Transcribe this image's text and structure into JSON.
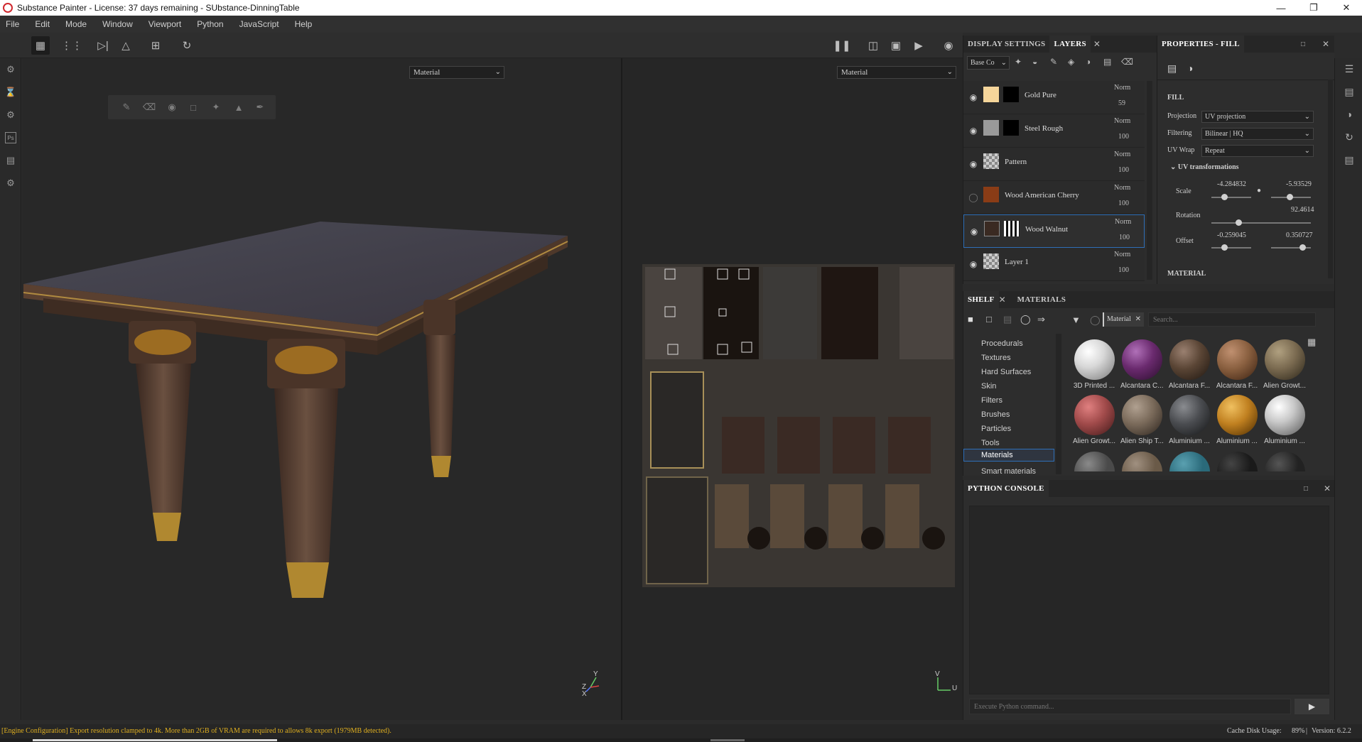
{
  "window": {
    "title": "Substance Painter - License: 37 days remaining - SUbstance-DinningTable"
  },
  "menu": [
    "File",
    "Edit",
    "Mode",
    "Window",
    "Viewport",
    "Python",
    "JavaScript",
    "Help"
  ],
  "viewports": {
    "left_mode": "Material",
    "right_mode": "Material"
  },
  "layers_panel": {
    "tabs": [
      "DISPLAY SETTINGS",
      "LAYERS"
    ],
    "channel_select": "Base Co",
    "layers": [
      {
        "name": "Gold Pure",
        "blend": "Norm",
        "opacity": "59",
        "visible": true,
        "color": "#f5d59a"
      },
      {
        "name": "Steel Rough",
        "blend": "Norm",
        "opacity": "100",
        "visible": true,
        "color": "#9a9a9a"
      },
      {
        "name": "Pattern",
        "blend": "Norm",
        "opacity": "100",
        "visible": true,
        "color": "checker"
      },
      {
        "name": "Wood American Cherry",
        "blend": "Norm",
        "opacity": "100",
        "visible": false,
        "color": "#8a3c16"
      },
      {
        "name": "Wood Walnut",
        "blend": "Norm",
        "opacity": "100",
        "visible": true,
        "color": "#3a2a22",
        "selected": true
      },
      {
        "name": "Layer 1",
        "blend": "Norm",
        "opacity": "100",
        "visible": true,
        "color": "checker"
      }
    ]
  },
  "properties": {
    "title": "PROPERTIES - FILL",
    "section": "FILL",
    "projection_label": "Projection",
    "projection": "UV projection",
    "filtering_label": "Filtering",
    "filtering": "Bilinear | HQ",
    "uvwrap_label": "UV Wrap",
    "uvwrap": "Repeat",
    "uvtrans_label": "UV transformations",
    "scale_label": "Scale",
    "scale_u": "-4.284832",
    "scale_v": "-5.93529",
    "rotation_label": "Rotation",
    "rotation": "92.4614",
    "offset_label": "Offset",
    "offset_u": "-0.259045",
    "offset_v": "0.350727",
    "material_section": "MATERIAL"
  },
  "shelf": {
    "tabs": [
      "SHELF",
      "MATERIALS"
    ],
    "filter_tag": "Material",
    "search_placeholder": "Search...",
    "categories": [
      "Procedurals",
      "Textures",
      "Hard Surfaces",
      "Skin",
      "Filters",
      "Brushes",
      "Particles",
      "Tools",
      "Materials",
      "Smart materials"
    ],
    "selected_category": "Materials",
    "materials": [
      {
        "label": "3D Printed ...",
        "color": "#d8d8d8"
      },
      {
        "label": "Alcantara C...",
        "color": "#6a2a6e"
      },
      {
        "label": "Alcantara F...",
        "color": "#5a4535"
      },
      {
        "label": "Alcantara F...",
        "color": "#8a6040"
      },
      {
        "label": "Alien Growt...",
        "color": "#7a6a50"
      },
      {
        "label": "Alien Growt...",
        "color": "#a04a4a"
      },
      {
        "label": "Alien Ship T...",
        "color": "#7a6a5a"
      },
      {
        "label": "Aluminium ...",
        "color": "#4a4c50"
      },
      {
        "label": "Aluminium ...",
        "color": "#c08020"
      },
      {
        "label": "Aluminium ...",
        "color": "#c8c8c8"
      }
    ]
  },
  "python_console": {
    "title": "PYTHON CONSOLE",
    "input_placeholder": "Execute Python command..."
  },
  "status": {
    "message": "[Engine Configuration] Export resolution clamped to 4k. More than 2GB of VRAM are required to allows 8k export (1979MB detected).",
    "disk_label": "Cache Disk Usage:",
    "disk_value": "89%",
    "version": "Version: 6.2.2"
  },
  "accent": "#2f6fb7"
}
